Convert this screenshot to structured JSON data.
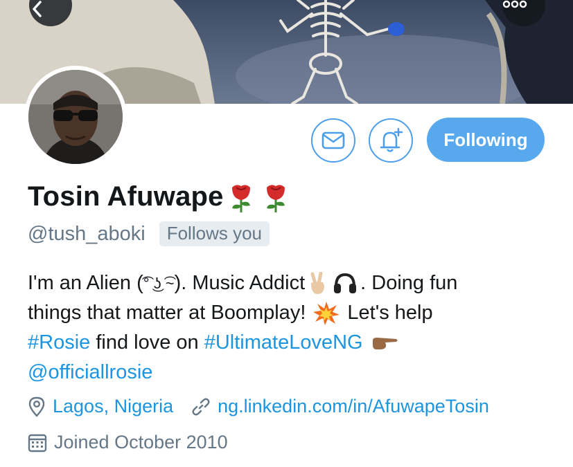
{
  "header": {
    "back_icon": "chevron-left-icon",
    "more_icon": "more-dots-icon"
  },
  "actions": {
    "message_icon": "envelope-icon",
    "notification_icon": "bell-plus-icon",
    "following_label": "Following",
    "accent_color": "#58a8ee"
  },
  "profile": {
    "name": "Tosin Afuwape",
    "name_emojis": [
      "rose-emoji",
      "rose-emoji"
    ],
    "handle": "@tush_aboki",
    "follows_you": "Follows you"
  },
  "bio": {
    "l1_a": "I'm an Alien (",
    "l1_face": "͡° ͜ʖ ͡~",
    "l1_b": "). Music Addict",
    "l1_c": ". Doing fun",
    "l2_a": "things that matter at Boomplay!",
    "l2_b": "Let's help",
    "l3_hashtag1": "#Rosie",
    "l3_mid": "find love on",
    "l3_hashtag2": "#UltimateLoveNG",
    "l4_mention": "@officiallrosie"
  },
  "meta": {
    "location_icon": "location-pin-icon",
    "location": "Lagos, Nigeria",
    "link_icon": "link-icon",
    "website": "ng.linkedin.com/in/AfuwapeTosin",
    "calendar_icon": "calendar-icon",
    "joined": "Joined October 2010"
  }
}
